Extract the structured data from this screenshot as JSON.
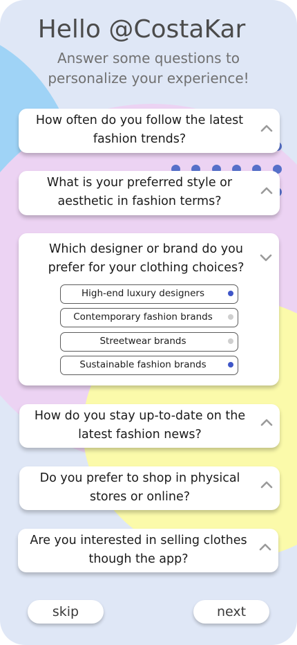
{
  "header": {
    "title": "Hello @CostaKar",
    "subtitle": "Answer some questions to personalize your experience!"
  },
  "questions": [
    {
      "text": "How often do you follow the latest fashion trends?",
      "expanded": false,
      "icon": "chevron-up-icon"
    },
    {
      "text": "What is your preferred style or aesthetic in fashion terms?",
      "expanded": false,
      "icon": "chevron-up-icon"
    },
    {
      "text": "Which designer or brand do you prefer for your clothing choices?",
      "expanded": true,
      "icon": "chevron-down-icon",
      "options": [
        {
          "label": "High-end luxury designers",
          "selected": true
        },
        {
          "label": "Contemporary fashion brands",
          "selected": false
        },
        {
          "label": "Streetwear brands",
          "selected": false
        },
        {
          "label": "Sustainable fashion brands",
          "selected": true
        }
      ]
    },
    {
      "text": "How do you stay up-to-date on the latest fashion news?",
      "expanded": false,
      "icon": "chevron-up-icon"
    },
    {
      "text": "Do you prefer to shop in physical stores or online?",
      "expanded": false,
      "icon": "chevron-up-icon"
    },
    {
      "text": "Are you interested in selling clothes though the app?",
      "expanded": false,
      "icon": "chevron-up-icon"
    }
  ],
  "actions": {
    "skip_label": "skip",
    "next_label": "next"
  },
  "colors": {
    "background": "#dfe7f6",
    "blob_blue": "#9fd3f6",
    "blob_pink": "#ecd3f3",
    "blob_yellow": "#fbfaaa",
    "dot_accent": "#5670c9",
    "radio_selected": "#3f56c8",
    "radio_unselected": "#cfcfcf"
  }
}
